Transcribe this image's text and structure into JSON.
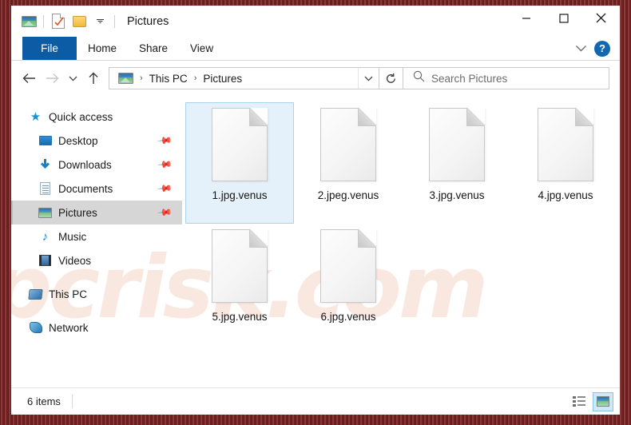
{
  "window": {
    "title": "Pictures",
    "quick_access_icons": [
      "pictures-icon",
      "properties-checklist-icon",
      "new-folder-icon",
      "customize-chevron-icon"
    ],
    "controls": {
      "minimize": "—",
      "maximize": "☐",
      "close": "✕"
    }
  },
  "ribbon": {
    "tabs": [
      {
        "label": "File",
        "active": true
      },
      {
        "label": "Home",
        "active": false
      },
      {
        "label": "Share",
        "active": false
      },
      {
        "label": "View",
        "active": false
      }
    ],
    "expand_label": "⌄",
    "help_label": "?"
  },
  "navigation": {
    "back": "←",
    "forward": "→",
    "recent": "⌄",
    "up": "↑",
    "refresh": "↻",
    "dropdown": "⌄",
    "breadcrumb": {
      "icon": "pictures-icon",
      "parts": [
        "This PC",
        "Pictures"
      ],
      "separator": "›"
    }
  },
  "search": {
    "placeholder": "Search Pictures",
    "value": "",
    "icon": "search-icon"
  },
  "sidebar": {
    "items": [
      {
        "label": "Quick access",
        "icon": "star-icon",
        "pinned": false,
        "indent": false,
        "selected": false
      },
      {
        "label": "Desktop",
        "icon": "desktop-icon",
        "pinned": true,
        "indent": true,
        "selected": false
      },
      {
        "label": "Downloads",
        "icon": "download-icon",
        "pinned": true,
        "indent": true,
        "selected": false
      },
      {
        "label": "Documents",
        "icon": "documents-icon",
        "pinned": true,
        "indent": true,
        "selected": false
      },
      {
        "label": "Pictures",
        "icon": "pictures-icon",
        "pinned": true,
        "indent": true,
        "selected": true
      },
      {
        "label": "Music",
        "icon": "music-icon",
        "pinned": false,
        "indent": true,
        "selected": false
      },
      {
        "label": "Videos",
        "icon": "videos-icon",
        "pinned": false,
        "indent": true,
        "selected": false
      },
      {
        "label": "This PC",
        "icon": "this-pc-icon",
        "pinned": false,
        "indent": false,
        "selected": false
      },
      {
        "label": "Network",
        "icon": "network-icon",
        "pinned": false,
        "indent": false,
        "selected": false
      }
    ],
    "pin_glyph": "📌"
  },
  "files": [
    {
      "name": "1.jpg.venus",
      "icon": "blank-document-icon",
      "selected": true
    },
    {
      "name": "2.jpeg.venus",
      "icon": "blank-document-icon",
      "selected": false
    },
    {
      "name": "3.jpg.venus",
      "icon": "blank-document-icon",
      "selected": false
    },
    {
      "name": "4.jpg.venus",
      "icon": "blank-document-icon",
      "selected": false
    },
    {
      "name": "5.jpg.venus",
      "icon": "blank-document-icon",
      "selected": false
    },
    {
      "name": "6.jpg.venus",
      "icon": "blank-document-icon",
      "selected": false
    }
  ],
  "status": {
    "item_count": "6 items",
    "view_details_icon": "details-view-icon",
    "view_thumbnails_icon": "large-icons-view-icon",
    "active_view": "large-icons"
  },
  "watermark": {
    "text": "pcrisk.com"
  },
  "colors": {
    "frame": "#7d2223",
    "accent": "#0c5ca5",
    "selection": "#e4f1fb",
    "selection_border": "#a8d4f0",
    "sidebar_selected": "#d6d6d6",
    "help_blue": "#1167b1"
  }
}
